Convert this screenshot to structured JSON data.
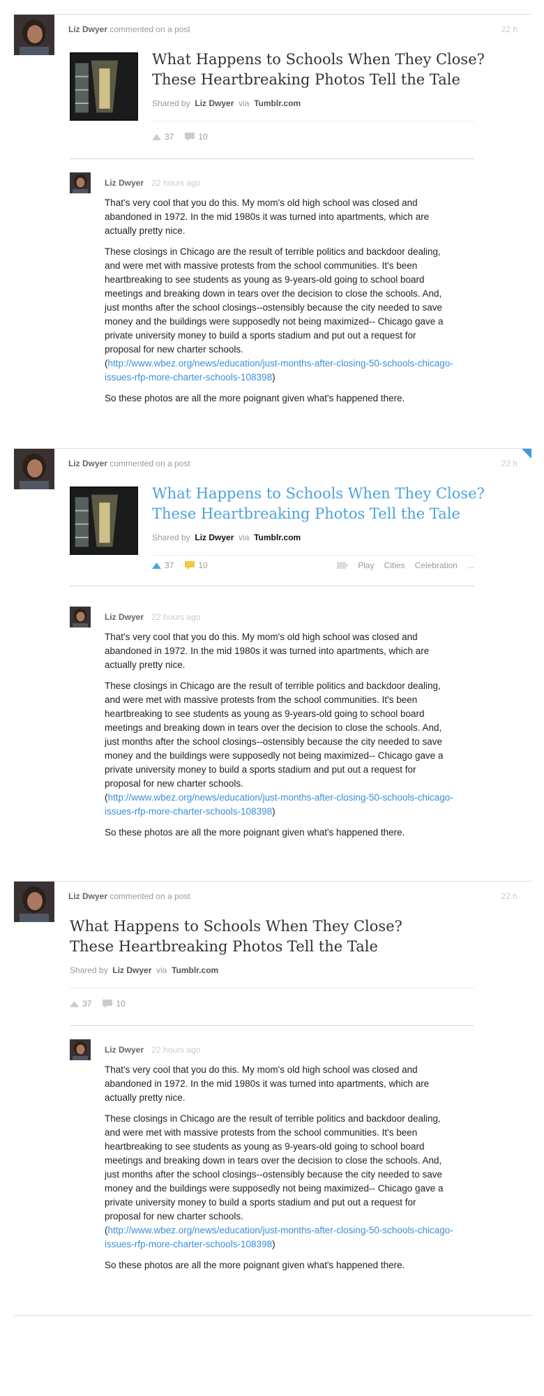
{
  "posts": [
    {
      "user": "Liz Dwyer",
      "action": "commented on a post",
      "time": "22 h",
      "title": "What Happens to Schools When They Close? These Heartbreaking Photos Tell the Tale",
      "shared_by_label": "Shared by",
      "shared_by": "Liz Dwyer",
      "via_label": "via",
      "via": "Tumblr.com",
      "upvotes": "37",
      "comments_count": "10",
      "comment": {
        "user": "Liz Dwyer",
        "time": "22 hours ago",
        "p1": "That's very cool that you do this. My mom's old high school was closed and abandoned in 1972. In the mid 1980s it was turned into apartments, which are actually pretty nice.",
        "p2": "These closings in Chicago are the result of terrible politics and backdoor dealing, and were met with massive protests from the school communities. It's been heartbreaking to see students as young as 9-years-old going to school board meetings and breaking down in tears over the decision to close the schools. And, just months after the school closings--ostensibly because the city needed to save money and the buildings were supposedly not being maximized-- Chicago gave a private university money to build a sports stadium and put out a request for proposal for new charter schools.",
        "link_open": "(",
        "link": "http://www.wbez.org/news/education/just-months-after-closing-50-schools-chicago-issues-rfp-more-charter-schools-108398",
        "link_close": ")",
        "p3": "So these photos are all the more poignant given what's happened there."
      }
    },
    {
      "user": "Liz Dwyer",
      "action": "commented on a post",
      "time": "22 h",
      "title": "What Happens to Schools When They Close? These Heartbreaking Photos Tell the Tale",
      "shared_by_label": "Shared by",
      "shared_by": "Liz Dwyer",
      "via_label": "via",
      "via": "Tumblr.com",
      "upvotes": "37",
      "comments_count": "10",
      "tags": [
        "Play",
        "Cities",
        "Celebration",
        "..."
      ],
      "comment": {
        "user": "Liz Dwyer",
        "time": "22 hours ago",
        "p1": "That's very cool that you do this. My mom's old high school was closed and abandoned in 1972. In the mid 1980s it was turned into apartments, which are actually pretty nice.",
        "p2": "These closings in Chicago are the result of terrible politics and backdoor dealing, and were met with massive protests from the school communities. It's been heartbreaking to see students as young as 9-years-old going to school board meetings and breaking down in tears over the decision to close the schools. And, just months after the school closings--ostensibly because the city needed to save money and the buildings were supposedly not being maximized-- Chicago gave a private university money to build a sports stadium and put out a request for proposal for new charter schools.",
        "link_open": "(",
        "link": "http://www.wbez.org/news/education/just-months-after-closing-50-schools-chicago-issues-rfp-more-charter-schools-108398",
        "link_close": ")",
        "p3": "So these photos are all the more poignant given what's happened there."
      }
    },
    {
      "user": "Liz Dwyer",
      "action": "commented on a post",
      "time": "22 h",
      "title": "What Happens to Schools When They Close? These Heartbreaking Photos Tell the Tale",
      "shared_by_label": "Shared by",
      "shared_by": "Liz Dwyer",
      "via_label": "via",
      "via": "Tumblr.com",
      "upvotes": "37",
      "comments_count": "10",
      "comment": {
        "user": "Liz Dwyer",
        "time": "22 hours ago",
        "p1": "That's very cool that you do this. My mom's old high school was closed and abandoned in 1972. In the mid 1980s it was turned into apartments, which are actually pretty nice.",
        "p2": "These closings in Chicago are the result of terrible politics and backdoor dealing, and were met with massive protests from the school communities. It's been heartbreaking to see students as young as 9-years-old going to school board meetings and breaking down in tears over the decision to close the schools. And, just months after the school closings--ostensibly because the city needed to save money and the buildings were supposedly not being maximized-- Chicago gave a private university money to build a sports stadium and put out a request for proposal for new charter schools.",
        "link_open": "(",
        "link": "http://www.wbez.org/news/education/just-months-after-closing-50-schools-chicago-issues-rfp-more-charter-schools-108398",
        "link_close": ")",
        "p3": "So these photos are all the more poignant given what's happened there."
      }
    }
  ],
  "colors": {
    "accent": "#4aa3df",
    "link": "#3b8fd9",
    "active_upvote": "#4aa3df",
    "active_comment": "#f5c842",
    "muted": "#cccccc"
  },
  "icons": [
    "user-avatar",
    "post-thumbnail",
    "upvote-icon",
    "comment-icon",
    "tag-icon"
  ]
}
